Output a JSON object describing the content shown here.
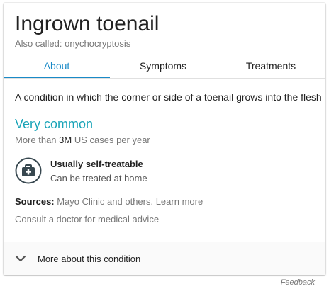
{
  "card": {
    "title": "Ingrown toenail",
    "also_called": "Also called: onychocryptosis"
  },
  "tabs": [
    {
      "label": "About",
      "selected": true
    },
    {
      "label": "Symptoms",
      "selected": false
    },
    {
      "label": "Treatments",
      "selected": false
    }
  ],
  "about": {
    "description": "A condition in which the corner or side of a toenail grows into the flesh",
    "frequency": "Very common",
    "cases_prefix": "More than ",
    "cases_count": "3M",
    "cases_suffix": " US cases per year",
    "treatment": {
      "icon": "first-aid-kit-icon",
      "title": "Usually self-treatable",
      "subtitle": "Can be treated at home"
    },
    "sources_label": "Sources:",
    "sources_text": " Mayo Clinic and others. Learn more",
    "consult": "Consult a doctor for medical advice"
  },
  "more": {
    "label": "More about this condition",
    "icon": "chevron-down-icon"
  },
  "feedback": "Feedback",
  "colors": {
    "accent": "#1a8ac7",
    "frequency": "#1aa4b8",
    "icon_dark": "#37474f"
  }
}
